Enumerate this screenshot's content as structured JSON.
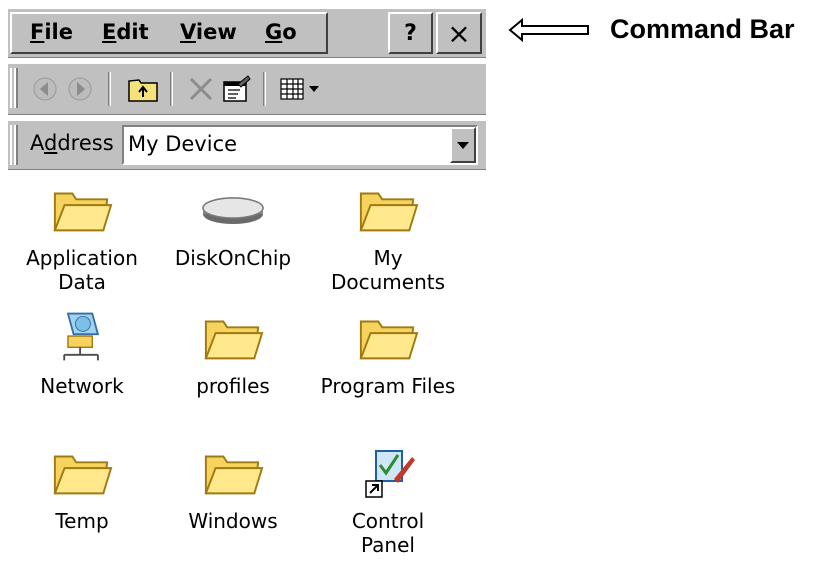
{
  "menu": {
    "file": {
      "accel": "F",
      "rest": "ile"
    },
    "edit": {
      "accel": "E",
      "rest": "dit"
    },
    "view": {
      "accel": "V",
      "rest": "iew"
    },
    "go": {
      "accel": "G",
      "rest": "o"
    },
    "help_label": "?",
    "close_label": "×"
  },
  "address": {
    "label_pre": "A",
    "label_accel": "d",
    "label_post": "dress",
    "value": "My Device"
  },
  "items": [
    {
      "line1": "Application",
      "line2": "Data",
      "icon": "folder-icon"
    },
    {
      "line1": "DiskOnChip",
      "line2": "",
      "icon": "disk-drive-icon"
    },
    {
      "line1": "My",
      "line2": "Documents",
      "icon": "folder-icon"
    },
    {
      "line1": "Network",
      "line2": "",
      "icon": "network-icon"
    },
    {
      "line1": "profiles",
      "line2": "",
      "icon": "folder-icon"
    },
    {
      "line1": "Program Files",
      "line2": "",
      "icon": "folder-icon"
    },
    {
      "line1": "Temp",
      "line2": "",
      "icon": "folder-icon"
    },
    {
      "line1": "Windows",
      "line2": "",
      "icon": "folder-icon"
    },
    {
      "line1": "Control",
      "line2": "Panel",
      "icon": "control-panel-shortcut-icon"
    }
  ],
  "annotation": {
    "label": "Command Bar"
  }
}
